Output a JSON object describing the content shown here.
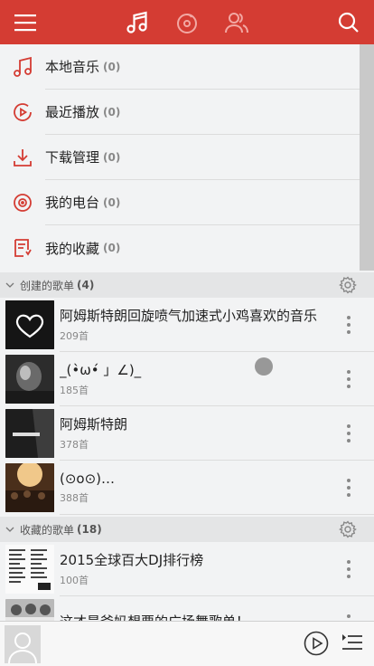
{
  "header": {
    "icons": [
      "menu-icon",
      "music-note-icon",
      "disc-icon",
      "friends-icon",
      "search-icon"
    ],
    "accent_color": "#d43c33"
  },
  "menu": {
    "items": [
      {
        "label": "本地音乐",
        "count": "(0)",
        "icon": "music-note-icon"
      },
      {
        "label": "最近播放",
        "count": "(0)",
        "icon": "recent-play-icon"
      },
      {
        "label": "下载管理",
        "count": "(0)",
        "icon": "download-icon"
      },
      {
        "label": "我的电台",
        "count": "(0)",
        "icon": "radio-icon"
      },
      {
        "label": "我的收藏",
        "count": "(0)",
        "icon": "collection-icon"
      }
    ]
  },
  "created_section": {
    "title": "创建的歌单",
    "count": "(4)",
    "playlists": [
      {
        "title": "阿姆斯特朗回旋喷气加速式小鸡喜欢的音乐",
        "sub": "209首"
      },
      {
        "title": "_(•̀ω•́ 」∠)_",
        "sub": "185首"
      },
      {
        "title": "阿姆斯特朗",
        "sub": "378首"
      },
      {
        "title": "(⊙o⊙)…",
        "sub": "388首"
      }
    ]
  },
  "collected_section": {
    "title": "收藏的歌单",
    "count": "(18)",
    "playlists": [
      {
        "title": "2015全球百大DJ排行榜",
        "sub": "100首"
      },
      {
        "title": "这才是爸妈想要的广场舞歌单！",
        "sub": ""
      }
    ]
  },
  "player": {
    "icons": [
      "avatar-icon",
      "play-icon",
      "playlist-queue-icon"
    ]
  }
}
